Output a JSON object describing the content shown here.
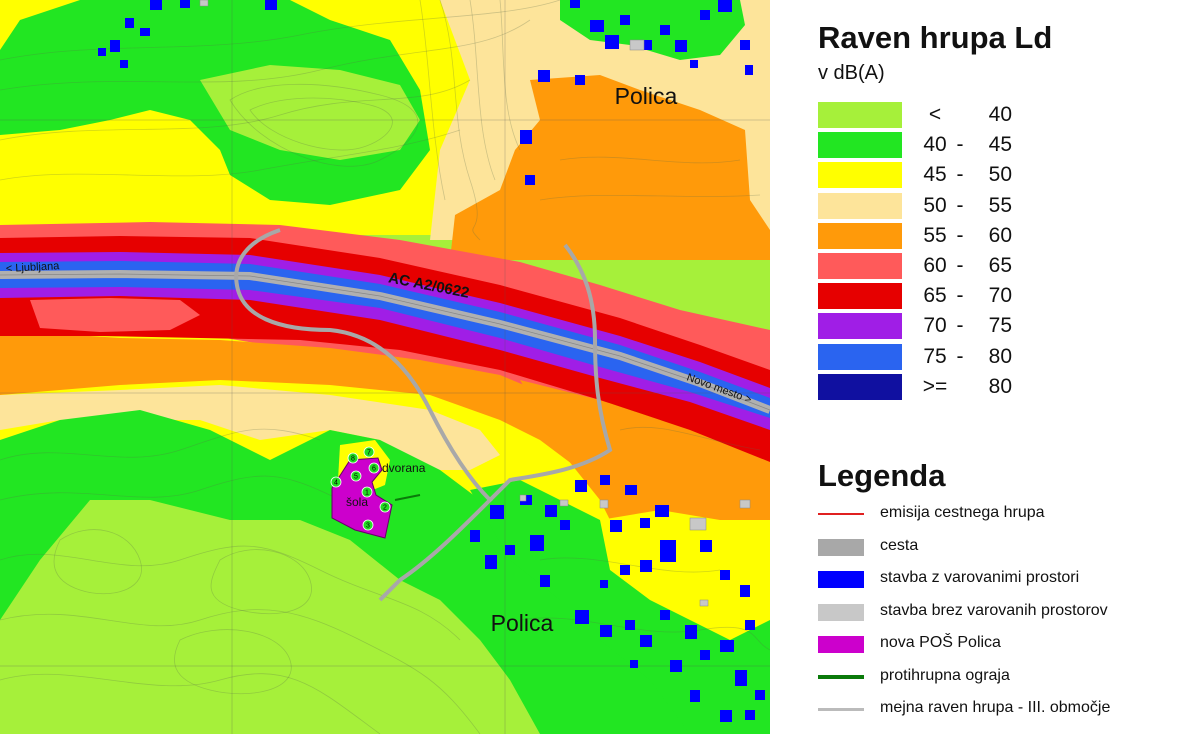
{
  "map": {
    "place_labels": [
      "Polica",
      "Polica"
    ],
    "road_label": "AC A2/0622",
    "direction_west": "< Ljubljana",
    "direction_east": "Novo mesto >",
    "building_labels": [
      "dvorana",
      "šola"
    ],
    "school_markers": [
      "8",
      "7",
      "6",
      "5",
      "4",
      "1",
      "2",
      "3"
    ]
  },
  "noise_legend": {
    "title": "Raven hrupa Ld",
    "unit": "v dB(A)",
    "classes": [
      {
        "lo": "<",
        "dash": "",
        "hi": "40",
        "color": "#a6f03a"
      },
      {
        "lo": "40",
        "dash": "-",
        "hi": "45",
        "color": "#22e622"
      },
      {
        "lo": "45",
        "dash": "-",
        "hi": "50",
        "color": "#ffff00"
      },
      {
        "lo": "50",
        "dash": "-",
        "hi": "55",
        "color": "#fde49a"
      },
      {
        "lo": "55",
        "dash": "-",
        "hi": "60",
        "color": "#ff9a0a"
      },
      {
        "lo": "60",
        "dash": "-",
        "hi": "65",
        "color": "#ff5a5a"
      },
      {
        "lo": "65",
        "dash": "-",
        "hi": "70",
        "color": "#e60000"
      },
      {
        "lo": "70",
        "dash": "-",
        "hi": "75",
        "color": "#a01ee6"
      },
      {
        "lo": "75",
        "dash": "-",
        "hi": "80",
        "color": "#2a64f0"
      },
      {
        "lo": ">=",
        "dash": "",
        "hi": "80",
        "color": "#1010a0"
      }
    ]
  },
  "symbol_legend": {
    "title": "Legenda",
    "items": [
      {
        "label": "emisija cestnega hrupa",
        "symbol": "red-line",
        "color": "#e02020"
      },
      {
        "label": "cesta",
        "symbol": "gray-box",
        "color": "#a8a8a8"
      },
      {
        "label": "stavba z varovanimi prostori",
        "symbol": "blue-box",
        "color": "#0000ff"
      },
      {
        "label": "stavba brez varovanih prostorov",
        "symbol": "lightgray-box",
        "color": "#c8c8c8"
      },
      {
        "label": "nova POŠ Polica",
        "symbol": "magenta-box",
        "color": "#cc00cc"
      },
      {
        "label": "protihrupna ograja",
        "symbol": "green-line",
        "color": "#0a7a0a"
      },
      {
        "label": "mejna raven hrupa - III. območje",
        "symbol": "gray-line",
        "color": "#bbbbbb"
      }
    ]
  }
}
